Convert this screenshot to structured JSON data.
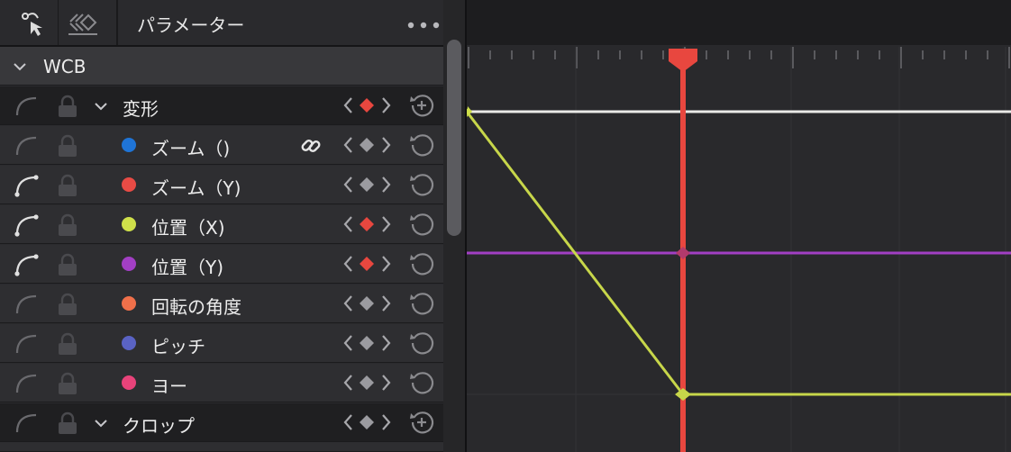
{
  "header": {
    "title": "パラメーター"
  },
  "wcb": {
    "label": "WCB"
  },
  "groups": [
    {
      "label": "変形",
      "keyframe_color": "#e8473f"
    },
    {
      "label": "クロップ",
      "keyframe_color": "#9b9ba0"
    }
  ],
  "params": [
    {
      "label": "ズーム（)",
      "color": "#1f74d6",
      "keyframe_color": "#9b9ba0",
      "curve_active": false
    },
    {
      "label": "ズーム（Y)",
      "color": "#e84b45",
      "keyframe_color": "#9b9ba0",
      "curve_active": true
    },
    {
      "label": "位置（X)",
      "color": "#cfe04a",
      "keyframe_color": "#e8473f",
      "curve_active": true
    },
    {
      "label": "位置（Y)",
      "color": "#a23fc4",
      "keyframe_color": "#e8473f",
      "curve_active": true
    },
    {
      "label": "回転の角度",
      "color": "#f0704a",
      "keyframe_color": "#9b9ba0",
      "curve_active": false
    },
    {
      "label": "ピッチ",
      "color": "#5a63c4",
      "keyframe_color": "#9b9ba0",
      "curve_active": false
    },
    {
      "label": "ヨー",
      "color": "#e8437a",
      "keyframe_color": "#9b9ba0",
      "curve_active": false
    }
  ],
  "colors": {
    "playhead": "#e8473f",
    "zoom_curve": "#e9e9e6",
    "position_x_curve": "#c7d64a",
    "position_y_curve": "#a23fc4"
  },
  "icons": {
    "header_left": "curve-select-icon",
    "header_mid": "keyframe-diamonds-icon",
    "header_right": "more-dots-icon"
  }
}
